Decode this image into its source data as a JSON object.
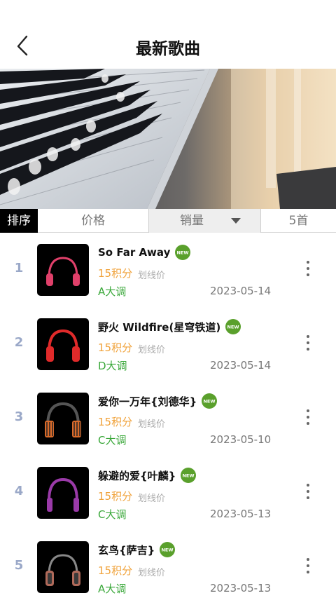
{
  "header": {
    "title": "最新歌曲"
  },
  "sortbar": {
    "label": "排序",
    "price": "价格",
    "sales": "销量",
    "count": "5首"
  },
  "items": [
    {
      "rank": "1",
      "title": "So Far Away",
      "price": "15积分",
      "strike": "划线价",
      "key": "A大调",
      "date": "2023-05-14",
      "badge": "NEW",
      "accent": "#e0406a"
    },
    {
      "rank": "2",
      "title": "野火 Wildfire(星穹铁道)",
      "price": "15积分",
      "strike": "划线价",
      "key": "D大调",
      "date": "2023-05-14",
      "badge": "NEW",
      "accent": "#e02a2a"
    },
    {
      "rank": "3",
      "title": "爱你一万年{刘德华}",
      "price": "15积分",
      "strike": "划线价",
      "key": "C大调",
      "date": "2023-05-10",
      "badge": "NEW",
      "accent": "#d86a2a"
    },
    {
      "rank": "4",
      "title": "躲避的爱{叶麟}",
      "price": "15积分",
      "strike": "划线价",
      "key": "C大调",
      "date": "2023-05-13",
      "badge": "NEW",
      "accent": "#9a3aa8"
    },
    {
      "rank": "5",
      "title": "玄鸟{萨吉}",
      "price": "15积分",
      "strike": "划线价",
      "key": "A大调",
      "date": "2023-05-13",
      "badge": "NEW",
      "accent": "#b06a5a"
    }
  ],
  "colors": {
    "price": "#f0a23a",
    "key": "#3aa83a",
    "rank": "#9aa8c8",
    "badge": "#5aa02c"
  }
}
